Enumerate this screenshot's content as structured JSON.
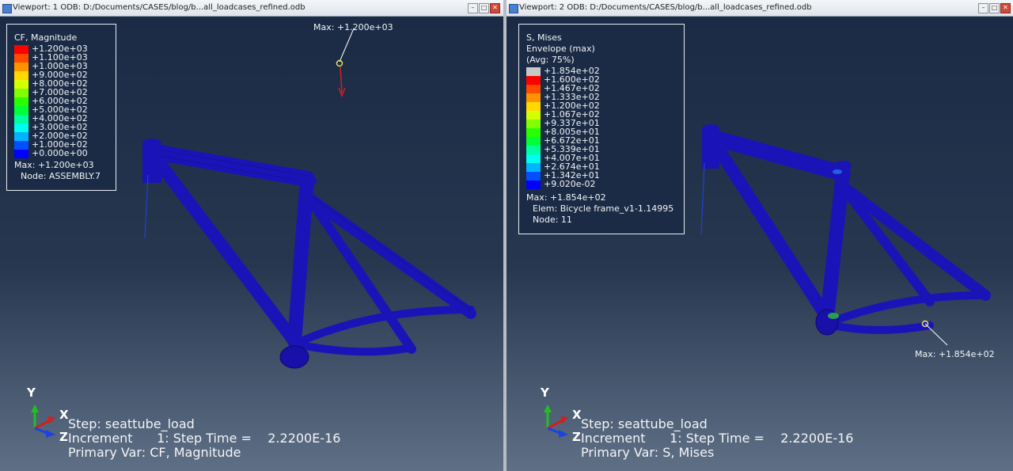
{
  "viewports": [
    {
      "title": "Viewport: 1    ODB: D:/Documents/CASES/blog/b...all_loadcases_refined.odb",
      "legend": {
        "title_lines": [
          "CF, Magnitude"
        ],
        "entries": [
          {
            "label": "+1.200e+03",
            "color": "#ff0000"
          },
          {
            "label": "+1.100e+03",
            "color": "#ff4a00"
          },
          {
            "label": "+1.000e+03",
            "color": "#ff9400"
          },
          {
            "label": "+9.000e+02",
            "color": "#ffd800"
          },
          {
            "label": "+8.000e+02",
            "color": "#d6ff00"
          },
          {
            "label": "+7.000e+02",
            "color": "#80ff00"
          },
          {
            "label": "+6.000e+02",
            "color": "#2aff00"
          },
          {
            "label": "+5.000e+02",
            "color": "#00ff36"
          },
          {
            "label": "+4.000e+02",
            "color": "#00ff9e"
          },
          {
            "label": "+3.000e+02",
            "color": "#00ffee"
          },
          {
            "label": "+2.000e+02",
            "color": "#00b4ff"
          },
          {
            "label": "+1.000e+02",
            "color": "#0050ff"
          },
          {
            "label": "+0.000e+00",
            "color": "#0000ff"
          }
        ],
        "footer": [
          "Max: +1.200e+03",
          "Node: ASSEMBLY.7"
        ]
      },
      "max_label": "Max: +1.200e+03",
      "status": {
        "step": "Step: seattube_load",
        "increment": "Increment      1: Step Time =    2.2200E-16",
        "primary_var": "Primary Var: CF, Magnitude"
      },
      "triad": {
        "x": "X",
        "y": "Y",
        "z": "Z"
      }
    },
    {
      "title": "Viewport: 2    ODB: D:/Documents/CASES/blog/b...all_loadcases_refined.odb",
      "legend": {
        "title_lines": [
          "S, Mises",
          "Envelope (max)",
          "(Avg: 75%)"
        ],
        "entries": [
          {
            "label": "+1.854e+02",
            "color": "#c8c8c8"
          },
          {
            "label": "+1.600e+02",
            "color": "#ff0000"
          },
          {
            "label": "+1.467e+02",
            "color": "#ff4a00"
          },
          {
            "label": "+1.333e+02",
            "color": "#ff9400"
          },
          {
            "label": "+1.200e+02",
            "color": "#ffd800"
          },
          {
            "label": "+1.067e+02",
            "color": "#d6ff00"
          },
          {
            "label": "+9.337e+01",
            "color": "#80ff00"
          },
          {
            "label": "+8.005e+01",
            "color": "#2aff00"
          },
          {
            "label": "+6.672e+01",
            "color": "#00ff36"
          },
          {
            "label": "+5.339e+01",
            "color": "#00ff9e"
          },
          {
            "label": "+4.007e+01",
            "color": "#00ffee"
          },
          {
            "label": "+2.674e+01",
            "color": "#00b4ff"
          },
          {
            "label": "+1.342e+01",
            "color": "#0050ff"
          },
          {
            "label": "+9.020e-02",
            "color": "#0000ff"
          }
        ],
        "footer": [
          "Max: +1.854e+02",
          "Elem: Bicycle frame_v1-1.14995",
          "Node: 11"
        ]
      },
      "max_label": "Max: +1.854e+02",
      "status": {
        "step": "Step: seattube_load",
        "increment": "Increment      1: Step Time =    2.2200E-16",
        "primary_var": "Primary Var: S, Mises"
      },
      "triad": {
        "x": "X",
        "y": "Y",
        "z": "Z"
      }
    }
  ],
  "window_buttons": {
    "minimize": "–",
    "restore": "□",
    "close": "✕"
  },
  "colors": {
    "frame": "#1a14b8",
    "background_top": "#1b2a45",
    "load_arrow": "#d42020",
    "max_marker": "#e8e060"
  }
}
